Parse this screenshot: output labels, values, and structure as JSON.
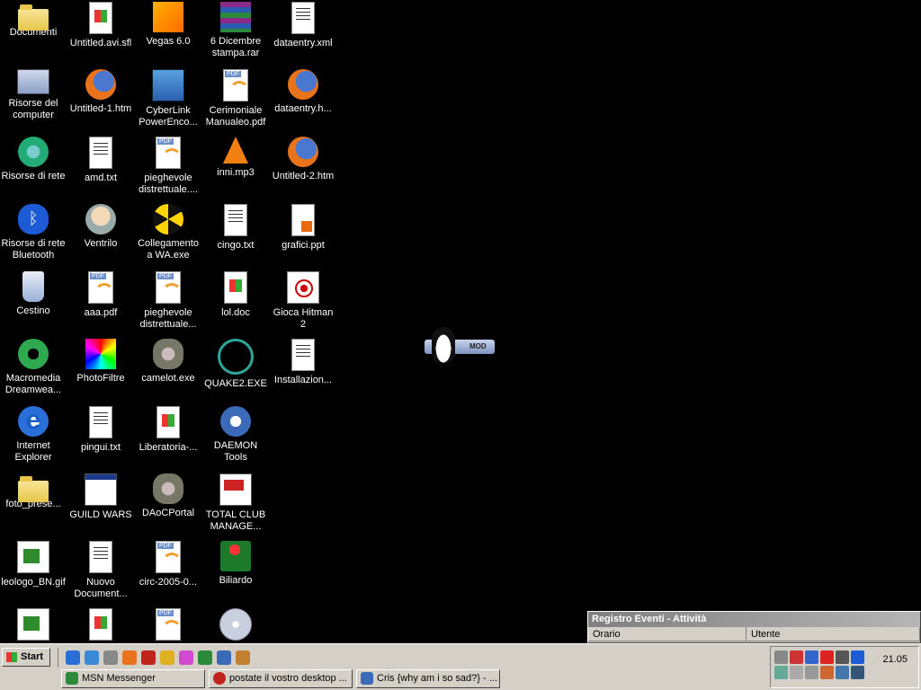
{
  "desktop": {
    "icons": [
      {
        "label": "Documenti",
        "glyph": "folder"
      },
      {
        "label": "Untitled.avi.sfl",
        "glyph": "win"
      },
      {
        "label": "Vegas 6.0",
        "glyph": "vegas"
      },
      {
        "label": "6 Dicembre stampa.rar",
        "glyph": "rar"
      },
      {
        "label": "dataentry.xml",
        "glyph": "doc"
      },
      {
        "label": "Risorse del computer",
        "glyph": "computer"
      },
      {
        "label": "Untitled-1.htm",
        "glyph": "firefox"
      },
      {
        "label": "CyberLink PowerEnco...",
        "glyph": "cyber"
      },
      {
        "label": "Cerimoniale Manualeo.pdf",
        "glyph": "pdf"
      },
      {
        "label": "dataentry.h...",
        "glyph": "firefox"
      },
      {
        "label": "Risorse di rete",
        "glyph": "net"
      },
      {
        "label": "amd.txt",
        "glyph": "doc"
      },
      {
        "label": "pieghevole distrettuale....",
        "glyph": "pdf"
      },
      {
        "label": "inni.mp3",
        "glyph": "vlc"
      },
      {
        "label": "Untitled-2.htm",
        "glyph": "firefox"
      },
      {
        "label": "Risorse di rete Bluetooth",
        "glyph": "bt"
      },
      {
        "label": "Ventrilo",
        "glyph": "head"
      },
      {
        "label": "Collegamento a WA.exe",
        "glyph": "nuke"
      },
      {
        "label": "cingo.txt",
        "glyph": "doc"
      },
      {
        "label": "grafici.ppt",
        "glyph": "ppt"
      },
      {
        "label": "Cestino",
        "glyph": "bin"
      },
      {
        "label": "aaa.pdf",
        "glyph": "pdf"
      },
      {
        "label": "pieghevole distrettuale...",
        "glyph": "pdf"
      },
      {
        "label": "lol.doc",
        "glyph": "win"
      },
      {
        "label": "Gioca Hitman 2",
        "glyph": "hitman"
      },
      {
        "label": "Macromedia Dreamwea...",
        "glyph": "mm"
      },
      {
        "label": "PhotoFiltre",
        "glyph": "photofiltre"
      },
      {
        "label": "camelot.exe",
        "glyph": "camelot"
      },
      {
        "label": "QUAKE2.EXE",
        "glyph": "quake"
      },
      {
        "label": "Installazion...",
        "glyph": "doc"
      },
      {
        "label": "Internet Explorer",
        "glyph": "ie"
      },
      {
        "label": "pingui.txt",
        "glyph": "doc"
      },
      {
        "label": "Liberatoria-...",
        "glyph": "win"
      },
      {
        "label": "DAEMON Tools",
        "glyph": "daemon"
      },
      {
        "label": "",
        "glyph": ""
      },
      {
        "label": "foto_prese...",
        "glyph": "folder"
      },
      {
        "label": "GUILD WARS",
        "glyph": "guild"
      },
      {
        "label": "DAoCPortal",
        "glyph": "camelot"
      },
      {
        "label": "TOTAL CLUB MANAGE...",
        "glyph": "total"
      },
      {
        "label": "",
        "glyph": ""
      },
      {
        "label": "leologo_BN.gif",
        "glyph": "gif"
      },
      {
        "label": "Nuovo Document...",
        "glyph": "doc"
      },
      {
        "label": "circ-2005-0...",
        "glyph": "pdf"
      },
      {
        "label": "Biliardo",
        "glyph": "biliardo"
      },
      {
        "label": "",
        "glyph": ""
      },
      {
        "label": "",
        "glyph": "gif"
      },
      {
        "label": "",
        "glyph": "win"
      },
      {
        "label": "",
        "glyph": "pdf"
      },
      {
        "label": "",
        "glyph": "cd"
      }
    ]
  },
  "tux_widget": {
    "tag": "MOD"
  },
  "event_panel": {
    "title": "Registro Eventi - Attività",
    "columns": [
      "Orario",
      "Utente"
    ]
  },
  "taskbar": {
    "start_label": "Start",
    "quick_launch": [
      "ie-icon",
      "desktop-icon",
      "notepad-icon",
      "firefox-icon",
      "opera-icon",
      "winamp-icon",
      "picasa-icon",
      "msn-icon",
      "search-icon",
      "mail-icon"
    ],
    "tasks": [
      {
        "label": "MSN Messenger",
        "color": "#2a8a3a"
      },
      {
        "label": "postate il vostro desktop ...",
        "color": "#c0241a"
      },
      {
        "label": "Cris {why am i so sad?} - ...",
        "color": "#3a6ab8"
      }
    ],
    "clock": "21.05"
  },
  "colors": {
    "desktop": "#000000",
    "taskbar": "#d4d0c8",
    "title_gradient_start": "#808080"
  }
}
